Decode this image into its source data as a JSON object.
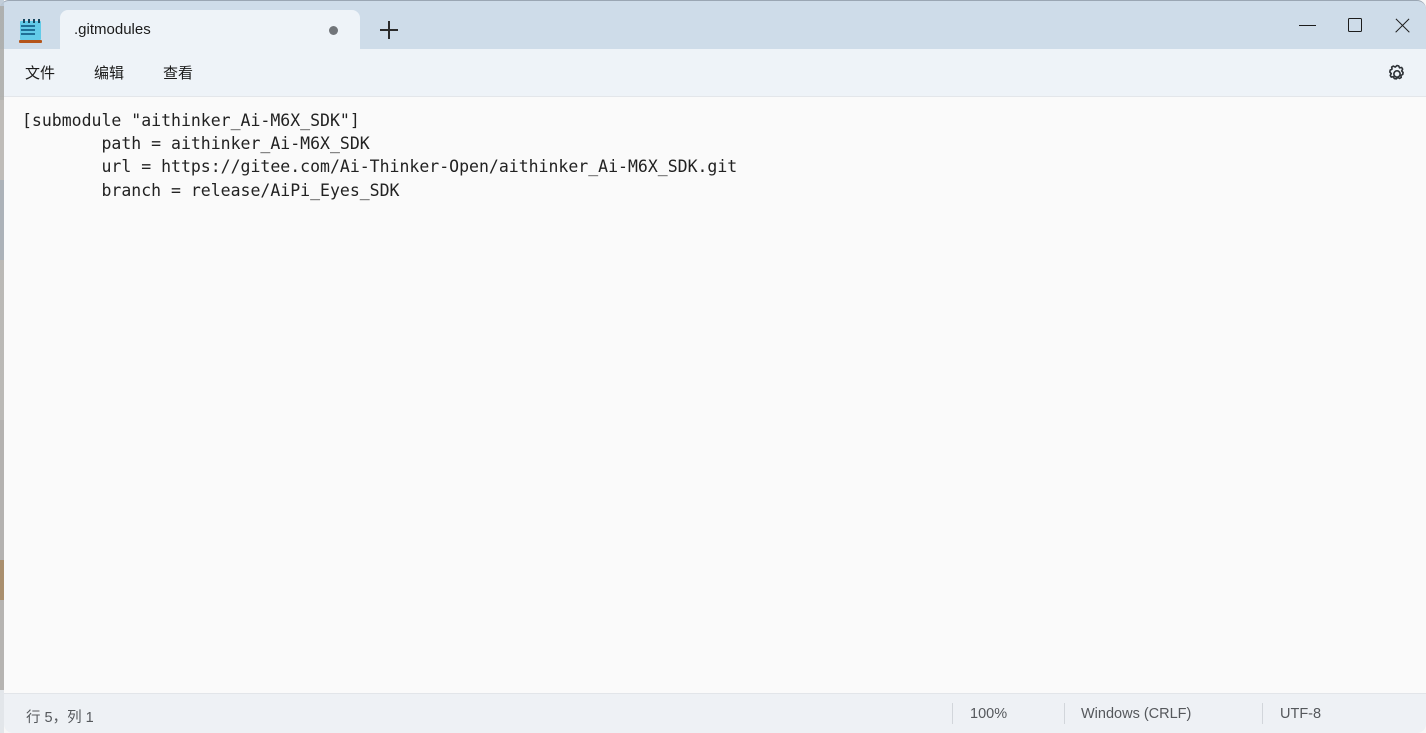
{
  "window": {
    "app_icon": "notepad-icon",
    "controls": {
      "minimize": "minimize-icon",
      "maximize": "maximize-icon",
      "close": "close-icon"
    }
  },
  "tabs": {
    "items": [
      {
        "label": ".gitmodules",
        "modified": true,
        "active": true
      }
    ],
    "new_tab_label": "+"
  },
  "menubar": {
    "items": [
      {
        "label": "文件"
      },
      {
        "label": "编辑"
      },
      {
        "label": "查看"
      }
    ],
    "settings_icon": "gear-icon"
  },
  "editor": {
    "content": "[submodule \"aithinker_Ai-M6X_SDK\"]\n        path = aithinker_Ai-M6X_SDK\n        url = https://gitee.com/Ai-Thinker-Open/aithinker_Ai-M6X_SDK.git\n        branch = release/AiPi_Eyes_SDK"
  },
  "statusbar": {
    "cursor_position": "行 5，列 1",
    "zoom": "100%",
    "line_ending": "Windows (CRLF)",
    "encoding": "UTF-8"
  },
  "colors": {
    "titlebar": "#cedce9",
    "menubar": "#eef3f8",
    "editor_bg": "#fafafa",
    "statusbar": "#eef1f5",
    "text": "#222222"
  }
}
